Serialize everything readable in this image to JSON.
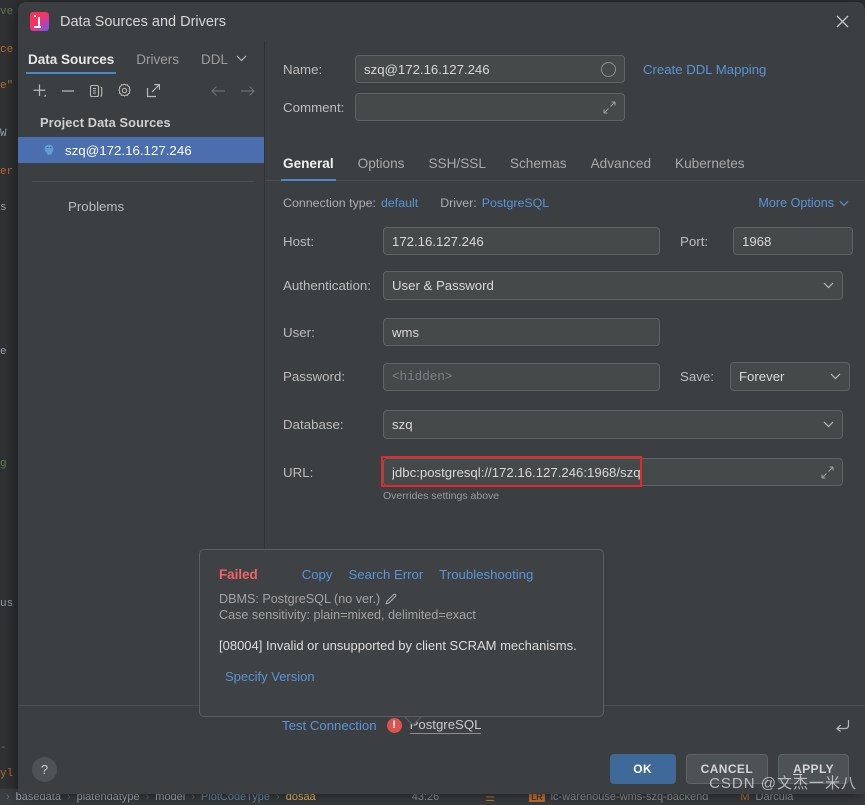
{
  "dialog": {
    "title": "Data Sources and Drivers",
    "close_icon": "close-icon",
    "app_icon": "datagrip-logo-icon"
  },
  "left_panel": {
    "tabs": [
      {
        "label": "Data Sources",
        "active": true
      },
      {
        "label": "Drivers",
        "active": false
      },
      {
        "label": "DDL",
        "active": false
      }
    ],
    "ddl_caret_icon": "chevron-down-icon",
    "toolbar": [
      {
        "name": "add-data-source-button",
        "icon": "plus-icon"
      },
      {
        "name": "remove-data-source-button",
        "icon": "minus-icon"
      },
      {
        "name": "duplicate-data-source-button",
        "icon": "copy-icon"
      },
      {
        "name": "data-source-properties-button",
        "icon": "gear-icon"
      },
      {
        "name": "jump-to-source-button",
        "icon": "external-link-icon"
      },
      {
        "name": "navigate-back-button",
        "icon": "arrow-left-icon"
      },
      {
        "name": "navigate-forward-button",
        "icon": "arrow-right-icon"
      }
    ],
    "group_label": "Project Data Sources",
    "data_source": {
      "label": "szq@172.16.127.246",
      "icon": "postgresql-elephant-icon"
    },
    "problems_label": "Problems"
  },
  "form": {
    "name_label": "Name:",
    "name_value": "szq@172.16.127.246",
    "color_circle_icon": "color-indicator-icon",
    "create_ddl_mapping": "Create DDL Mapping",
    "comment_label": "Comment:",
    "comment_value": "",
    "comment_expand_icon": "expand-icon"
  },
  "main_tabs": [
    {
      "label": "General",
      "active": true
    },
    {
      "label": "Options",
      "active": false
    },
    {
      "label": "SSH/SSL",
      "active": false
    },
    {
      "label": "Schemas",
      "active": false
    },
    {
      "label": "Advanced",
      "active": false
    },
    {
      "label": "Kubernetes",
      "active": false
    }
  ],
  "general": {
    "connection_type_label": "Connection type:",
    "connection_type_value": "default",
    "driver_label": "Driver:",
    "driver_value": "PostgreSQL",
    "more_options_label": "More Options",
    "more_options_icon": "chevron-down-icon",
    "host_label": "Host:",
    "host_value": "172.16.127.246",
    "port_label": "Port:",
    "port_value": "1968",
    "auth_label": "Authentication:",
    "auth_value": "User & Password",
    "user_label": "User:",
    "user_value": "wms",
    "password_label": "Password:",
    "password_placeholder": "<hidden>",
    "save_label": "Save:",
    "save_value": "Forever",
    "database_label": "Database:",
    "database_value": "szq",
    "url_label": "URL:",
    "url_value": "jdbc:postgresql://172.16.127.246:1968/szq",
    "url_expand_icon": "expand-icon",
    "url_hint": "Overrides settings above",
    "url_highlight_color": "#e8272c"
  },
  "error_balloon": {
    "status": "Failed",
    "status_color": "#f46363",
    "actions": [
      "Copy",
      "Search Error",
      "Troubleshooting"
    ],
    "dbms_line": "DBMS: PostgreSQL (no ver.)",
    "edit_icon": "pencil-icon",
    "case_sensitivity_line": "Case sensitivity: plain=mixed, delimited=exact",
    "message": "[08004] Invalid or unsupported by client SCRAM mechanisms.",
    "specify_version": "Specify Version"
  },
  "test_bar": {
    "test_connection_label": "Test Connection",
    "error_badge_icon": "error-circle-icon",
    "error_badge_glyph": "!",
    "driver_link": "PostgreSQL",
    "revert_icon": "revert-icon"
  },
  "footer": {
    "help_icon": "help-icon",
    "help_glyph": "?",
    "ok_label": "OK",
    "cancel_label": "CANCEL",
    "apply_label": "APPLY",
    "apply_mnemonic": "A",
    "apply_rest": "PPLY",
    "ok_color": "#3e6998"
  },
  "background": {
    "status_crumbs": [
      "basedata",
      "platendatype",
      "model",
      "PlotCodeType",
      "dosaa"
    ],
    "caret_position": "43:26",
    "branch_label": "lc-warehouse-wms-szq-backend",
    "theme_label": "Darcula"
  },
  "watermark": "CSDN @文杰一米八"
}
